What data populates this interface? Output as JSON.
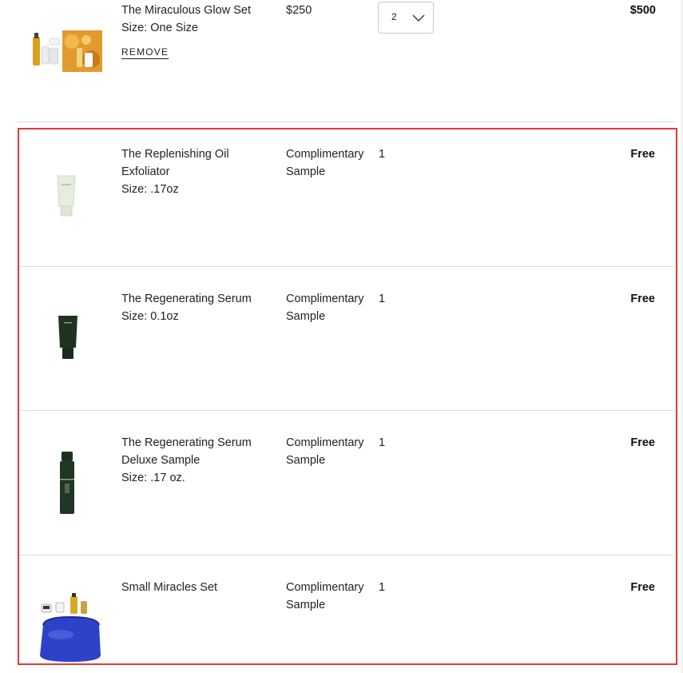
{
  "top_item": {
    "name": "The Miraculous Glow Set",
    "size": "Size: One Size",
    "price": "$250",
    "quantity": "2",
    "total": "$500",
    "remove_label": "REMOVE"
  },
  "samples": [
    {
      "name_lines": [
        "The Replenishing Oil",
        "Exfoliator"
      ],
      "size": "Size: .17oz",
      "price_lines": [
        "Complimentary",
        "Sample"
      ],
      "quantity": "1",
      "total": "Free"
    },
    {
      "name_lines": [
        "The Regenerating Serum",
        ""
      ],
      "size": "Size: 0.1oz",
      "price_lines": [
        "Complimentary",
        "Sample"
      ],
      "quantity": "1",
      "total": "Free"
    },
    {
      "name_lines": [
        "The Regenerating Serum",
        "Deluxe Sample"
      ],
      "size": "Size: .17 oz.",
      "price_lines": [
        "Complimentary",
        "Sample"
      ],
      "quantity": "1",
      "total": "Free"
    },
    {
      "name_lines": [
        "Small Miracles Set",
        ""
      ],
      "size": "",
      "price_lines": [
        "Complimentary",
        "Sample"
      ],
      "quantity": "1",
      "total": "Free"
    }
  ],
  "colors": {
    "highlight": "#e53935",
    "divider": "#dcdcdc"
  },
  "icons": {
    "quantity_dropdown": "chevron-down-icon"
  }
}
